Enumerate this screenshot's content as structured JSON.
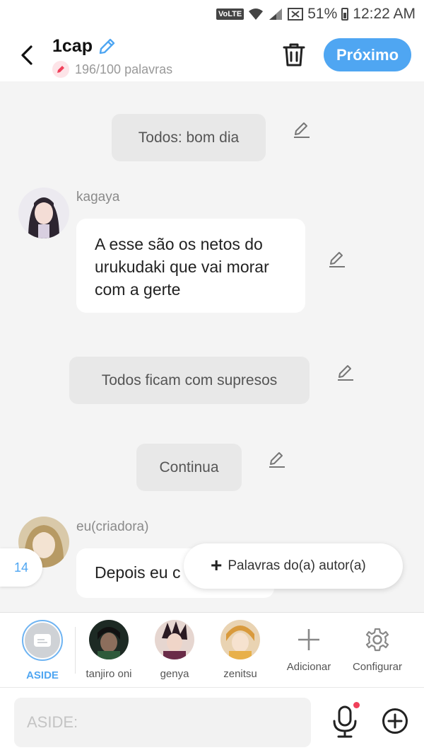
{
  "status_bar": {
    "network": "VoLTE",
    "battery": "51%",
    "time": "12:22 AM"
  },
  "header": {
    "title": "1cap",
    "word_count": "196/100 palavras",
    "next_label": "Próximo"
  },
  "messages": [
    {
      "type": "narration",
      "text": "Todos: bom dia"
    },
    {
      "type": "dialogue",
      "speaker": "kagaya",
      "text": "A esse são os netos do urukudaki que vai morar com a gerte"
    },
    {
      "type": "narration",
      "text": "Todos ficam com supresos"
    },
    {
      "type": "narration",
      "text": "Continua"
    },
    {
      "type": "dialogue",
      "speaker": "eu(criadora)",
      "text": "Depois eu c"
    }
  ],
  "count_badge": "14",
  "author_words_button": "Palavras do(a) autor(a)",
  "characters": [
    {
      "label": "ASIDE",
      "selected": true
    },
    {
      "label": "tanjiro oni"
    },
    {
      "label": "genya"
    },
    {
      "label": "zenitsu"
    },
    {
      "label": "Adicionar",
      "icon": "plus-icon"
    },
    {
      "label": "Configurar",
      "icon": "gear-icon"
    }
  ],
  "input": {
    "placeholder": "ASIDE:"
  },
  "colors": {
    "accent": "#4fa6f2",
    "recording": "#f0405a"
  }
}
